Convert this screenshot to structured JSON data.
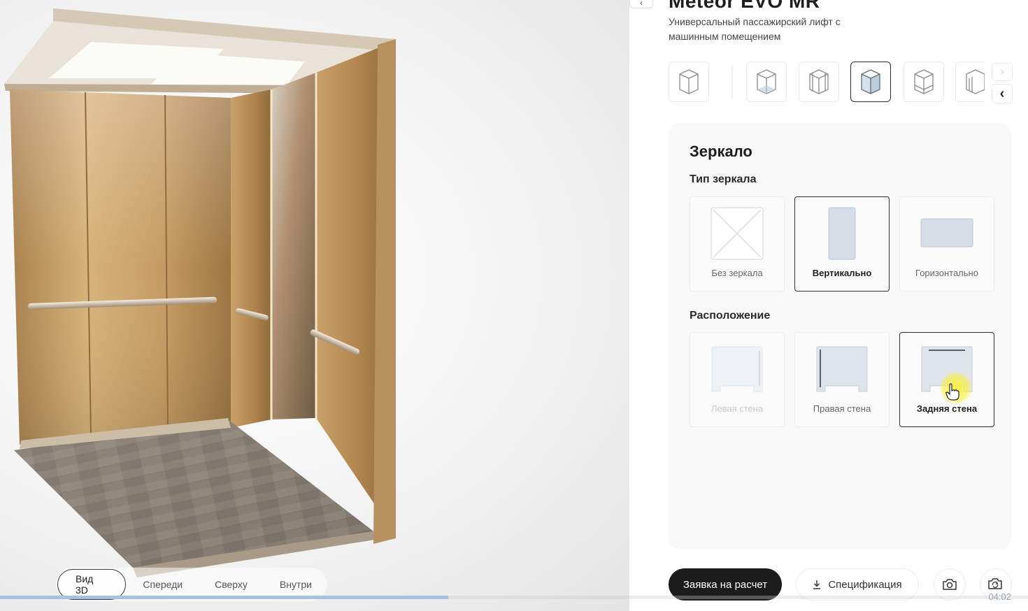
{
  "product": {
    "title": "Meteor EVO MR",
    "subtitle": "Универсальный пассажирский лифт с машинным помещением",
    "back_icon": "chevron-left-icon"
  },
  "view_thumbnails": {
    "items": [
      {
        "name": "thumb-cabin-1",
        "icon": "cube-icon",
        "selected": false
      },
      {
        "name": "thumb-cabin-2",
        "icon": "cabin-walls-icon",
        "selected": false
      },
      {
        "name": "thumb-cabin-3",
        "icon": "cabin-handrail-icon",
        "selected": false
      },
      {
        "name": "thumb-cabin-mirror",
        "icon": "cabin-mirror-icon",
        "selected": true
      },
      {
        "name": "thumb-cabin-5",
        "icon": "cabin-floor-icon",
        "selected": false
      },
      {
        "name": "thumb-cabin-6",
        "icon": "cabin-door-icon",
        "selected": false
      }
    ],
    "next_icon": "chevron-right-icon",
    "prev_icon": "chevron-left-icon"
  },
  "mirror": {
    "section_title": "Зеркало",
    "type_label": "Тип зеркала",
    "types": [
      {
        "label": "Без зеркала",
        "icon": "no-mirror-icon",
        "selected": false
      },
      {
        "label": "Вертикально",
        "icon": "vertical-mirror-icon",
        "selected": true
      },
      {
        "label": "Горизонтально",
        "icon": "horizontal-mirror-icon",
        "selected": false
      }
    ],
    "position_label": "Расположение",
    "positions": [
      {
        "label": "Левая стена",
        "icon": "left-wall-icon",
        "selected": false,
        "disabled": true
      },
      {
        "label": "Правая стена",
        "icon": "right-wall-icon",
        "selected": false,
        "disabled": false
      },
      {
        "label": "Задняя стена",
        "icon": "back-wall-icon",
        "selected": true,
        "disabled": false
      }
    ]
  },
  "view_tabs": [
    {
      "label": "Вид 3D",
      "active": true
    },
    {
      "label": "Спереди",
      "active": false
    },
    {
      "label": "Сверху",
      "active": false
    },
    {
      "label": "Внутри",
      "active": false
    }
  ],
  "actions": {
    "request_label": "Заявка на расчет",
    "spec_label": "Спецификация",
    "spec_icon": "download-icon",
    "screenshot_icon": "camera-icon",
    "gallery_icon": "camera-rotate-icon"
  },
  "video": {
    "progress_fraction": 0.436,
    "time": "04:02"
  },
  "colors": {
    "primary_button": "#1c1c1c",
    "selected_border": "#2e2e2e",
    "cabin_gold": "#c9a06a",
    "progress": "#a9c1dc",
    "cursor_highlight": "#f5eb3c"
  }
}
